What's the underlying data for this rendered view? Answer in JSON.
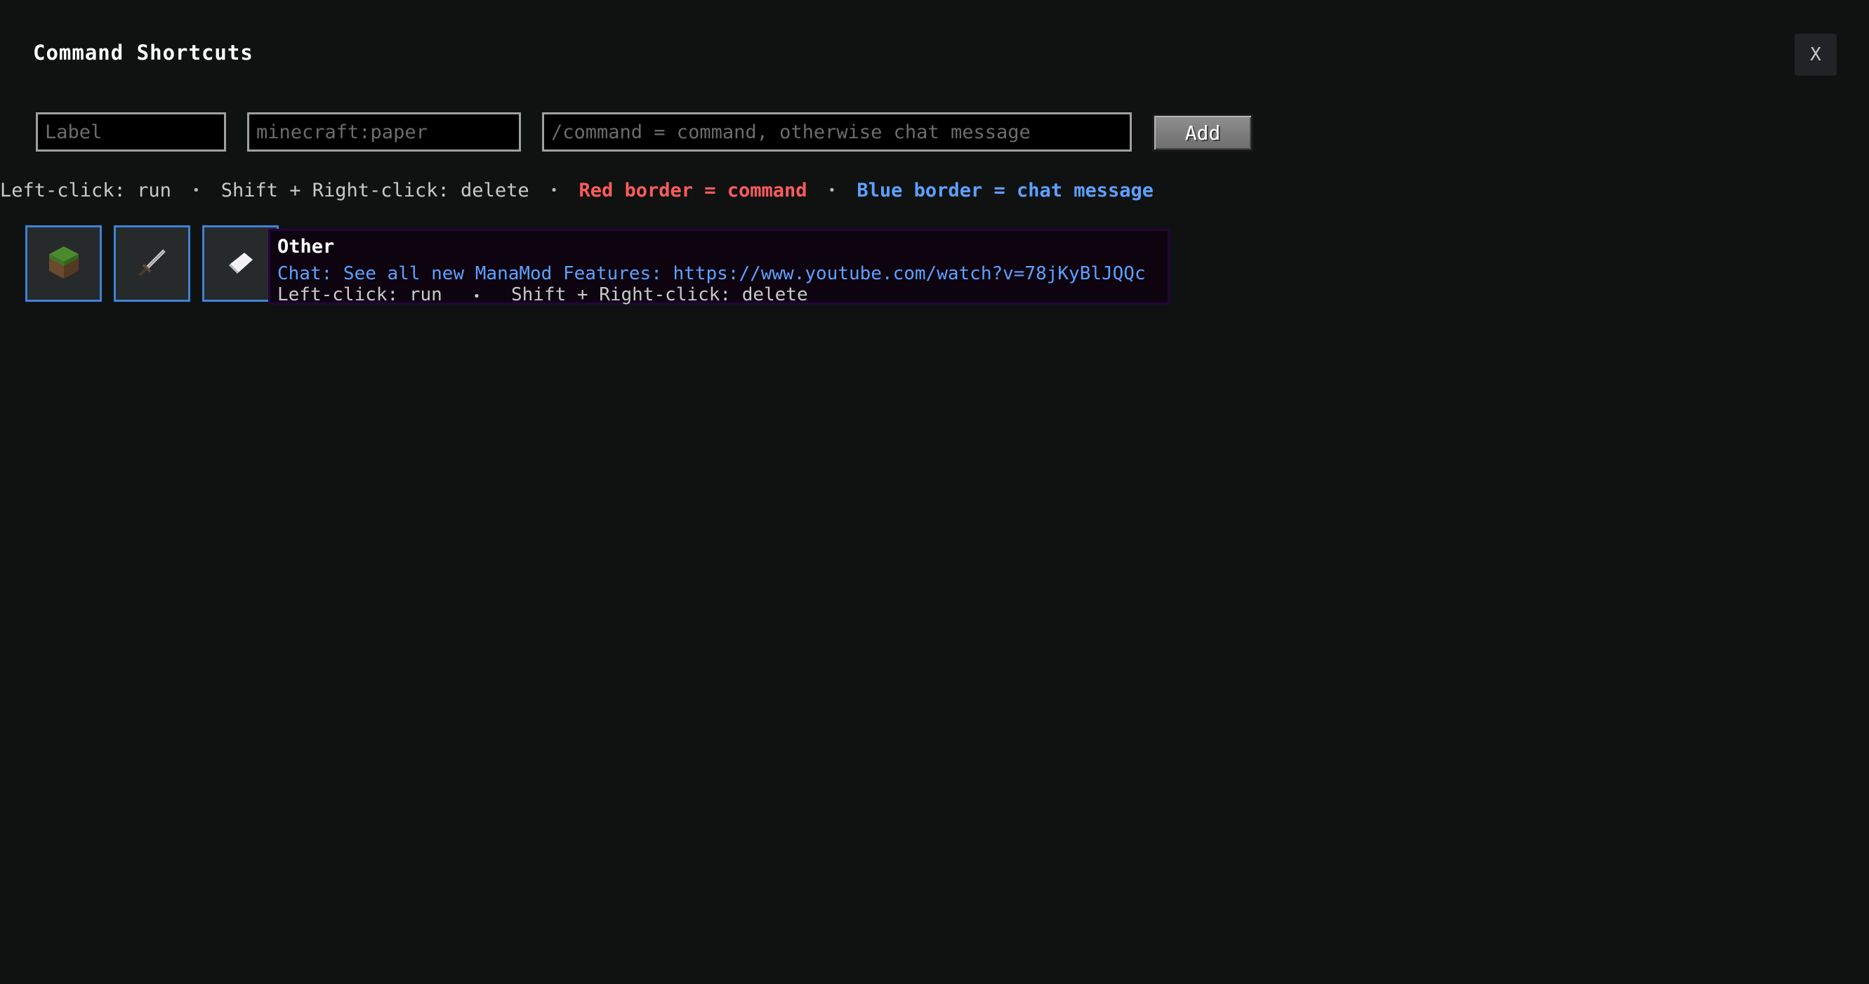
{
  "window": {
    "title": "Command Shortcuts",
    "close_label": "X"
  },
  "form": {
    "label_placeholder": "Label",
    "item_placeholder": "minecraft:paper",
    "command_placeholder": "/command = command, otherwise chat message",
    "add_label": "Add"
  },
  "help": {
    "left_click": "Left-click: run",
    "separator": "•",
    "shift_right_click": "Shift + Right-click: delete",
    "red_border": "Red border = command",
    "blue_border": "Blue border = chat message"
  },
  "shortcuts": [
    {
      "icon": "grass-block-icon",
      "border_color": "#3d82d6"
    },
    {
      "icon": "iron-sword-icon",
      "border_color": "#3d82d6"
    },
    {
      "icon": "paper-icon",
      "border_color": "#3d82d6"
    }
  ],
  "tooltip": {
    "title": "Other",
    "chat": "Chat: See all new ManaMod Features: https://www.youtube.com/watch?v=78jKyBlJQQc",
    "left_click": "Left-click: run",
    "separator": "•",
    "shift_right_click": "Shift + Right-click: delete"
  },
  "colors": {
    "background": "#0f1211",
    "command_border": "#ff5c5c",
    "chat_border": "#5ea0ff"
  }
}
